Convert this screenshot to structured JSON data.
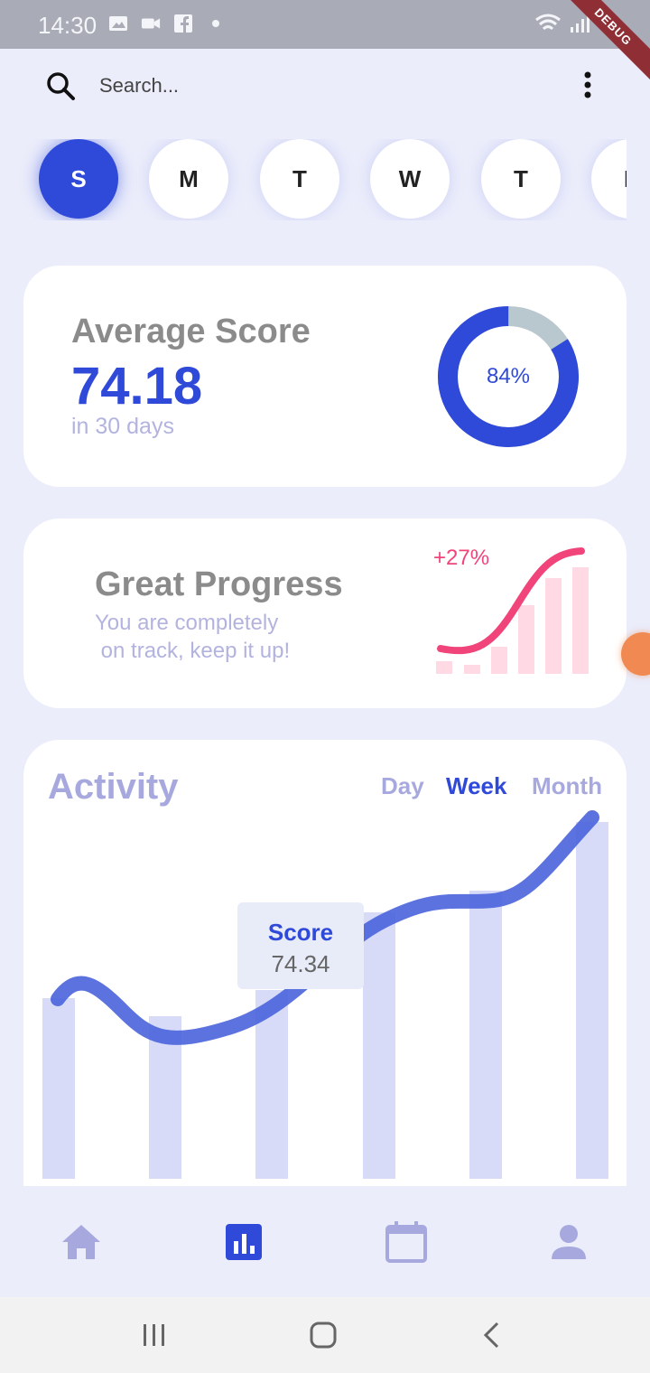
{
  "status_bar": {
    "time": "14:30",
    "debug_label": "DEBUG"
  },
  "search": {
    "placeholder": "Search..."
  },
  "days": [
    {
      "label": "S",
      "active": true
    },
    {
      "label": "M",
      "active": false
    },
    {
      "label": "T",
      "active": false
    },
    {
      "label": "W",
      "active": false
    },
    {
      "label": "T",
      "active": false
    },
    {
      "label": "F",
      "active": false
    }
  ],
  "score_card": {
    "title": "Average Score",
    "value": "74.18",
    "subtitle": "in 30 days",
    "ring_percent": 84,
    "ring_label": "84%"
  },
  "progress_card": {
    "title": "Great Progress",
    "subtitle": "You are completely\n on track, keep it up!",
    "change_label": "+27%"
  },
  "activity": {
    "title": "Activity",
    "tabs": [
      {
        "label": "Day",
        "active": false
      },
      {
        "label": "Week",
        "active": true
      },
      {
        "label": "Month",
        "active": false
      }
    ],
    "tooltip_label": "Score",
    "tooltip_value": "74.34"
  },
  "nav": {
    "items": [
      {
        "icon": "home-icon",
        "active": false
      },
      {
        "icon": "bar-chart-icon",
        "active": true
      },
      {
        "icon": "calendar-icon",
        "active": false
      },
      {
        "icon": "person-icon",
        "active": false
      }
    ]
  },
  "colors": {
    "accent": "#2f49d8",
    "pink": "#f0447a",
    "muted": "#a7a9de",
    "background": "#ebedfb"
  }
}
